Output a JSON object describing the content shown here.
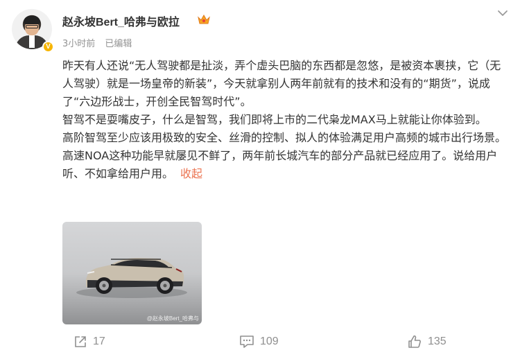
{
  "post": {
    "author": "赵永坡Bert_哈弗与欧拉",
    "time": "3小时前",
    "edited": "已编辑",
    "paragraphs": [
      "昨天有人还说“无人驾驶都是扯淡，弄个虚头巴脑的东西都是忽悠，是被资本裹挟，它（无人驾驶）就是一场皇帝的新装”，今天就拿别人两年前就有的技术和没有的“期货”，说成了“六边形战士，开创全民智驾时代”。",
      "智驾不是耍嘴皮子，什么是智驾，我们即将上市的二代枭龙MAX马上就能让你体验到。",
      "高阶智驾至少应该用极致的安全、丝滑的控制、拟人的体验满足用户高频的城市出行场景。高速NOA这种功能早就屡见不鲜了，两年前长城汽车的部分产品就已经应用了。说给用户听、不如拿给用户用。"
    ],
    "collapse_label": "收起",
    "image_watermark": "@赵永坡Bert_哈弗与",
    "verified_badge": "V"
  },
  "actions": {
    "share_count": "17",
    "comment_count": "109",
    "like_count": "135"
  },
  "colors": {
    "link": "#eb7350",
    "meta": "#939393",
    "badge": "#f7b500"
  },
  "icons": [
    "more-icon",
    "crown-icon",
    "share-icon",
    "comment-icon",
    "like-icon"
  ]
}
